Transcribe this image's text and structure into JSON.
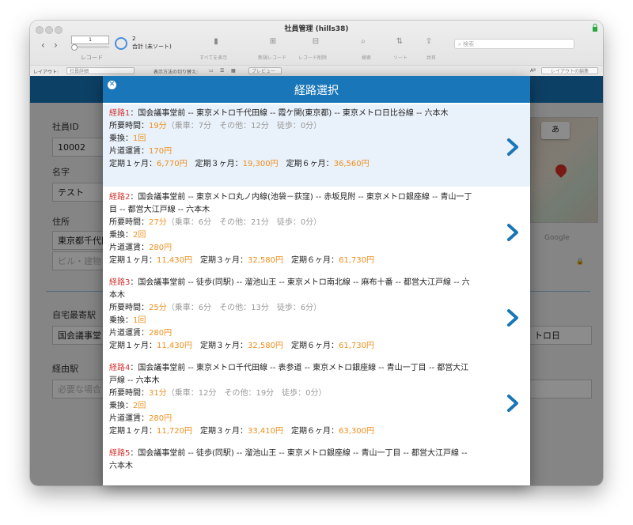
{
  "window": {
    "title": "社員管理 (hills38)"
  },
  "toolbar": {
    "record_value": "1",
    "record_label": "レコード",
    "count": "2",
    "count_label": "合計 (未ソート)",
    "show_all": "すべてを表示",
    "new_record": "新規レコード",
    "delete_record": "レコード削除",
    "find": "検索",
    "sort": "ソート",
    "share": "共有",
    "search_placeholder": "検索"
  },
  "layoutbar": {
    "layout_label": "レイアウト:",
    "layout_value": "社員詳細",
    "view_label": "表示方法の切り替え:",
    "preview": "プレビュー",
    "font_label": "Aª",
    "edit_layout": "レイアウトの編集"
  },
  "background_form": {
    "employee_id_label": "社員ID",
    "employee_id": "10002",
    "name_label": "名字",
    "name": "テスト",
    "address_label": "住所",
    "address": "東京都千代田",
    "building_placeholder": "ビル・建物",
    "home_station_label": "自宅最寄駅",
    "home_station": "国会議事堂",
    "right_station_partial": "トロ日",
    "via_station_label": "経由駅",
    "via_placeholder": "必要な場合",
    "map_button": "あ",
    "map_logo": "Google"
  },
  "modal": {
    "title": "経路選択",
    "routes": [
      {
        "label": "経路1",
        "path": "国会議事堂前 -- 東京メトロ千代田線 -- 霞ケ関(東京都) -- 東京メトロ日比谷線 -- 六本木",
        "time_label": "所要時間：",
        "time": "19分",
        "time_detail": "（乗車：7分　その他：12分　徒歩：0分）",
        "transfer_label": "乗換：",
        "transfer": "1回",
        "fare_label": "片道運賃：",
        "fare": "170円",
        "pass1_label": "定期１ヶ月：",
        "pass1": "6,770円",
        "pass3_label": "定期３ヶ月：",
        "pass3": "19,300円",
        "pass6_label": "定期６ヶ月：",
        "pass6": "36,560円"
      },
      {
        "label": "経路2",
        "path": "国会議事堂前 -- 東京メトロ丸ノ内線(池袋－荻窪) -- 赤坂見附 -- 東京メトロ銀座線 -- 青山一丁目 -- 都営大江戸線 -- 六本木",
        "time_label": "所要時間：",
        "time": "27分",
        "time_detail": "（乗車：6分　その他：21分　徒歩：0分）",
        "transfer_label": "乗換：",
        "transfer": "2回",
        "fare_label": "片道運賃：",
        "fare": "280円",
        "pass1_label": "定期１ヶ月：",
        "pass1": "11,430円",
        "pass3_label": "定期３ヶ月：",
        "pass3": "32,580円",
        "pass6_label": "定期６ヶ月：",
        "pass6": "61,730円"
      },
      {
        "label": "経路3",
        "path": "国会議事堂前 -- 徒歩(同駅) -- 溜池山王 -- 東京メトロ南北線 -- 麻布十番 -- 都営大江戸線 -- 六本木",
        "time_label": "所要時間：",
        "time": "25分",
        "time_detail": "（乗車：6分　その他：13分　徒歩：6分）",
        "transfer_label": "乗換：",
        "transfer": "1回",
        "fare_label": "片道運賃：",
        "fare": "280円",
        "pass1_label": "定期１ヶ月：",
        "pass1": "11,430円",
        "pass3_label": "定期３ヶ月：",
        "pass3": "32,580円",
        "pass6_label": "定期６ヶ月：",
        "pass6": "61,730円"
      },
      {
        "label": "経路4",
        "path": "国会議事堂前 -- 東京メトロ千代田線 -- 表参道 -- 東京メトロ銀座線 -- 青山一丁目 -- 都営大江戸線 -- 六本木",
        "time_label": "所要時間：",
        "time": "31分",
        "time_detail": "（乗車：12分　その他：19分　徒歩：0分）",
        "transfer_label": "乗換：",
        "transfer": "2回",
        "fare_label": "片道運賃：",
        "fare": "280円",
        "pass1_label": "定期１ヶ月：",
        "pass1": "11,720円",
        "pass3_label": "定期３ヶ月：",
        "pass3": "33,410円",
        "pass6_label": "定期６ヶ月：",
        "pass6": "63,300円"
      },
      {
        "label": "経路5",
        "path": "国会議事堂前 -- 徒歩(同駅) -- 溜池山王 -- 東京メトロ銀座線 -- 青山一丁目 -- 都営大江戸線 -- 六本木"
      }
    ]
  }
}
